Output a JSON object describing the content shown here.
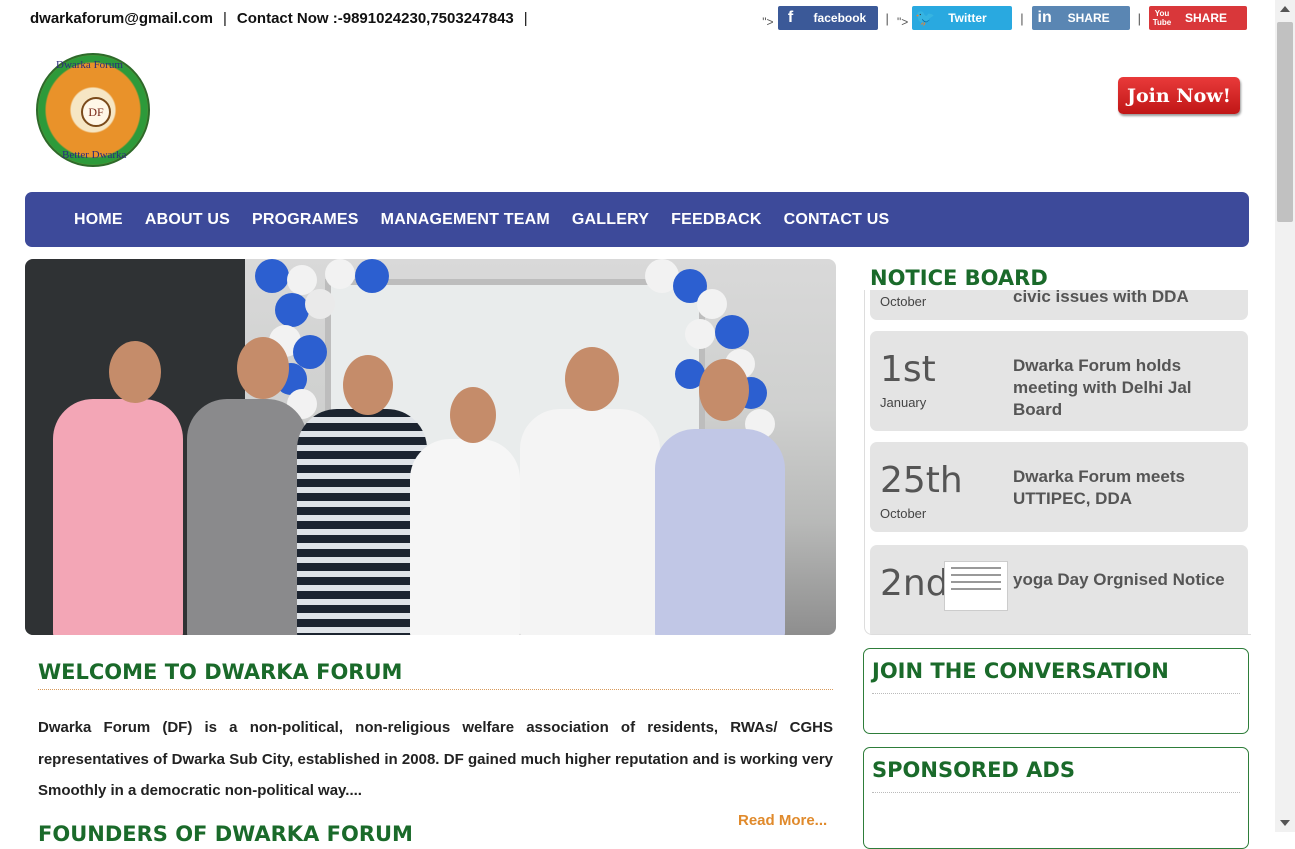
{
  "topbar": {
    "email": "dwarkaforum@gmail.com",
    "contact": "Contact Now :-9891024230,7503247843",
    "sep": "|"
  },
  "social": {
    "quote": "\">",
    "pipe": "|",
    "facebook": "facebook",
    "twitter": "Twitter",
    "linkedin": "SHARE",
    "youtube": "SHARE",
    "youtube_icon": "You Tube"
  },
  "logo": {
    "top_text": "Dwarka Forum",
    "center_text": "DF",
    "bottom_text": "Better Dwarka"
  },
  "join_button": "Join Now!",
  "nav": {
    "items": [
      "HOME",
      "ABOUT US",
      "PROGRAMES",
      "MANAGEMENT TEAM",
      "GALLERY",
      "FEEDBACK",
      "CONTACT US"
    ]
  },
  "notice_board": {
    "title": "NOTICE BOARD",
    "items": [
      {
        "day": "",
        "month": "October",
        "headline": "civic issues with DDA"
      },
      {
        "day": "1st",
        "month": "January",
        "headline": "Dwarka Forum holds meeting with Delhi Jal Board"
      },
      {
        "day": "25th",
        "month": "October",
        "headline": "Dwarka Forum meets UTTIPEC, DDA"
      },
      {
        "day": "2nd",
        "month": "",
        "headline": "yoga Day Orgnised Notice"
      }
    ]
  },
  "welcome": {
    "title": "WELCOME TO DWARKA FORUM",
    "body": "Dwarka Forum (DF) is a non-political, non-religious welfare association of residents, RWAs/ CGHS representatives of Dwarka Sub City, established in 2008. DF gained much higher reputation and is working very Smoothly in a democratic non-political way....",
    "read_more": "Read More..."
  },
  "founders_title": "FOUNDERS OF DWARKA FORUM",
  "boxes": {
    "conversation": "JOIN THE CONVERSATION",
    "ads": "SPONSORED ADS"
  },
  "colors": {
    "nav_bg": "#3d4a9a",
    "heading_green": "#1a6a2a",
    "read_more": "#e08a2c",
    "join_red": "#d62626"
  }
}
